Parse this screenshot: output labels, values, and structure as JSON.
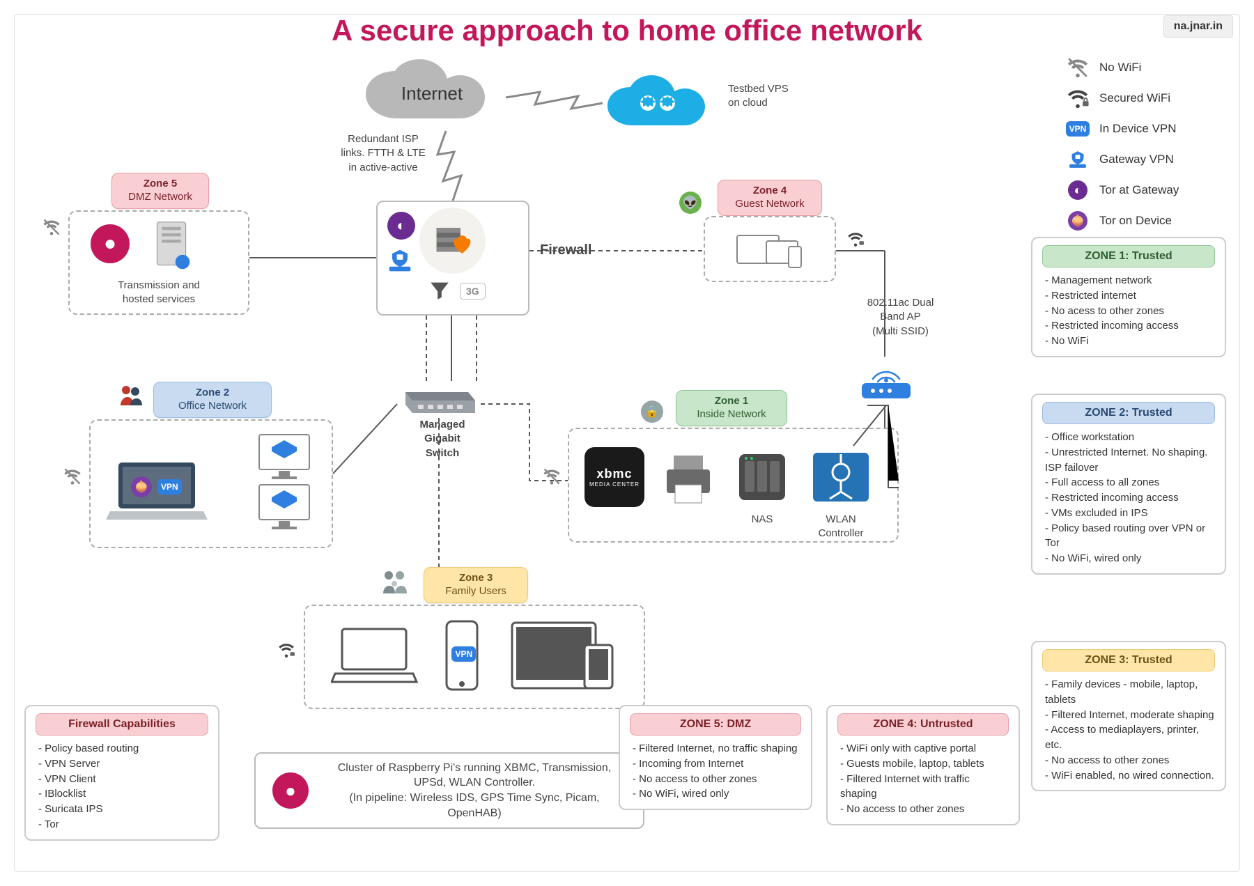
{
  "title": "A secure approach to home office network",
  "watermark": "na.jnar.in",
  "internet_label": "Internet",
  "firewall_label": "Firewall",
  "isp_note": "Redundant ISP\nlinks. FTTH & LTE\nin active-active",
  "vps_note": "Testbed VPS\non cloud",
  "switch_label": "Managed\nGigabit\nSwitch",
  "ap_note": "802.11ac Dual\nBand AP\n(Multi SSID)",
  "tg3g": "3G",
  "nas_label": "NAS",
  "wlan_label": "WLAN\nController",
  "vpn_mini": "VPN",
  "cluster_note": "Cluster of Raspberry Pi's running XBMC, Transmission, UPSd, WLAN Controller.\n(In pipeline: Wireless IDS, GPS Time Sync, Picam, OpenHAB)",
  "hosted": "Transmission and\nhosted services",
  "xbmc": "xbmc",
  "zones": {
    "z1": {
      "tag": "Zone 1",
      "name": "Inside Network"
    },
    "z2": {
      "tag": "Zone 2",
      "name": "Office Network"
    },
    "z3": {
      "tag": "Zone 3",
      "name": "Family Users"
    },
    "z4": {
      "tag": "Zone 4",
      "name": "Guest Network"
    },
    "z5": {
      "tag": "Zone 5",
      "name": "DMZ Network"
    }
  },
  "legend": {
    "no_wifi": "No WiFi",
    "sec_wifi": "Secured WiFi",
    "in_vpn": "In Device VPN",
    "gw_vpn": "Gateway VPN",
    "tor_gw": "Tor at Gateway",
    "tor_dev": "Tor on Device"
  },
  "cards": {
    "fw": {
      "title": "Firewall Capabilities",
      "items": [
        "Policy based routing",
        "VPN Server",
        "VPN Client",
        "IBlocklist",
        "Suricata IPS",
        "Tor"
      ]
    },
    "z1": {
      "title": "ZONE 1: Trusted",
      "items": [
        "Management network",
        "Restricted internet",
        "No acess to other zones",
        "Restricted incoming access",
        "No WiFi"
      ]
    },
    "z2": {
      "title": "ZONE 2: Trusted",
      "items": [
        "Office workstation",
        "Unrestricted Internet. No shaping. ISP failover",
        "Full access to all zones",
        "Restricted incoming access",
        "VMs excluded in IPS",
        "Policy based routing over VPN or Tor",
        "No WiFi, wired only"
      ]
    },
    "z3": {
      "title": "ZONE 3: Trusted",
      "items": [
        "Family devices - mobile, laptop, tablets",
        "Filtered Internet, moderate shaping",
        "Access to mediaplayers, printer, etc.",
        "No access to other zones",
        "WiFi enabled, no wired connection."
      ]
    },
    "z4": {
      "title": "ZONE 4: Untrusted",
      "items": [
        "WiFi only with captive portal",
        "Guests mobile, laptop, tablets",
        "Filtered Internet with traffic shaping",
        "No access to other zones"
      ]
    },
    "z5": {
      "title": "ZONE 5: DMZ",
      "items": [
        "Filtered Internet, no traffic shaping",
        "Incoming from Internet",
        "No access to other zones",
        "No WiFi, wired only"
      ]
    }
  }
}
